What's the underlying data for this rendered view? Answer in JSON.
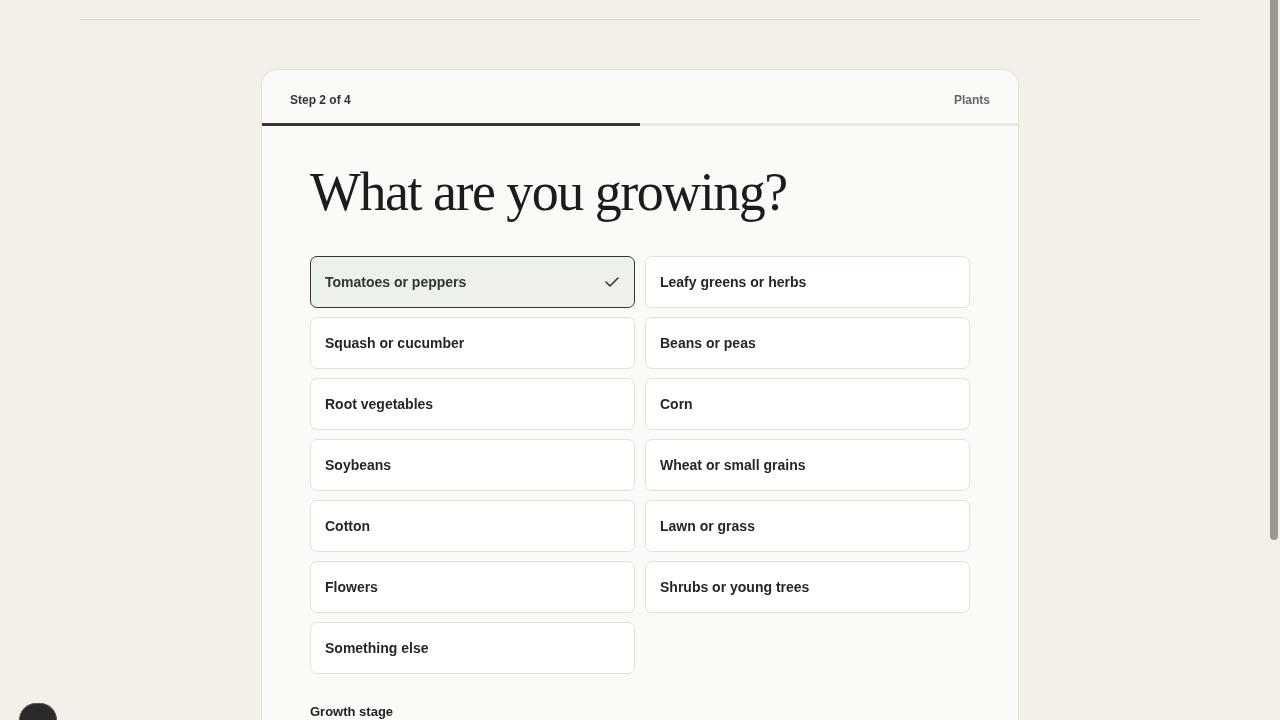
{
  "progress": {
    "step_label": "Step 2 of 4",
    "section": "Plants",
    "level": 0.5
  },
  "question": {
    "title": "What are you growing?"
  },
  "options": [
    {
      "label": "Tomatoes or peppers",
      "selected": true
    },
    {
      "label": "Leafy greens or herbs",
      "selected": false
    },
    {
      "label": "Squash or cucumber",
      "selected": false
    },
    {
      "label": "Beans or peas",
      "selected": false
    },
    {
      "label": "Root vegetables",
      "selected": false
    },
    {
      "label": "Corn",
      "selected": false
    },
    {
      "label": "Soybeans",
      "selected": false
    },
    {
      "label": "Wheat or small grains",
      "selected": false
    },
    {
      "label": "Cotton",
      "selected": false
    },
    {
      "label": "Lawn or grass",
      "selected": false
    },
    {
      "label": "Flowers",
      "selected": false
    },
    {
      "label": "Shrubs or young trees",
      "selected": false
    },
    {
      "label": "Something else",
      "selected": false
    }
  ],
  "next_section": {
    "label": "Growth stage"
  }
}
